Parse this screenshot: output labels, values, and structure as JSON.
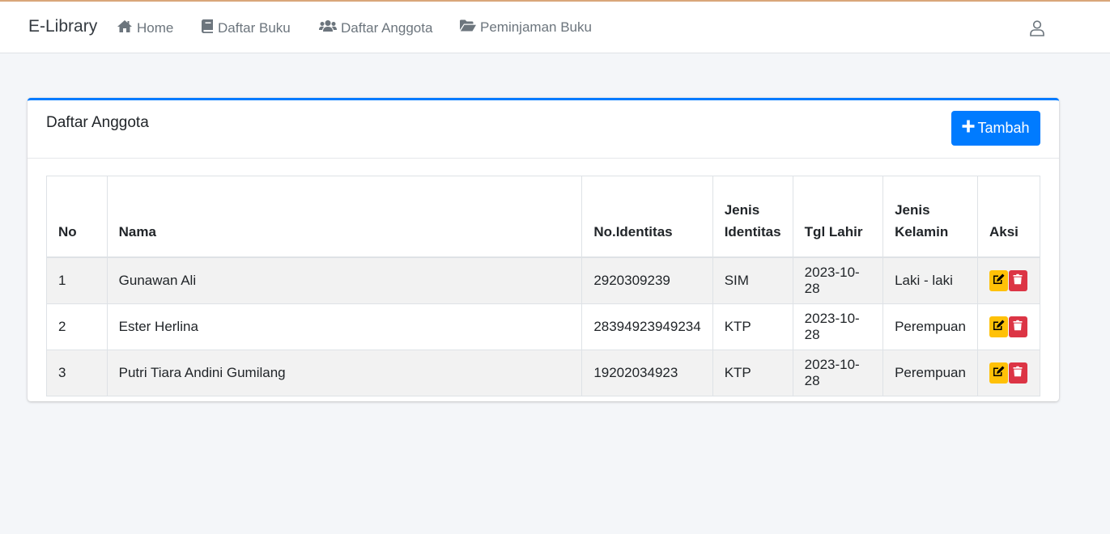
{
  "navbar": {
    "brand": "E-Library",
    "items": [
      {
        "label": "Home",
        "icon": "home-icon"
      },
      {
        "label": "Daftar Buku",
        "icon": "book-icon"
      },
      {
        "label": "Daftar Anggota",
        "icon": "users-icon"
      },
      {
        "label": "Peminjaman Buku",
        "icon": "folder-open-icon"
      }
    ],
    "user_icon": "user-icon"
  },
  "card": {
    "title": "Daftar Anggota",
    "add_button": "Tambah"
  },
  "table": {
    "headers": [
      "No",
      "Nama",
      "No.Identitas",
      "Jenis Identitas",
      "Tgl Lahir",
      "Jenis Kelamin",
      "Aksi"
    ],
    "rows": [
      {
        "no": "1",
        "nama": "Gunawan Ali",
        "no_identitas": "2920309239",
        "jenis_identitas": "SIM",
        "tgl_lahir": "2023-10-28",
        "jenis_kelamin": "Laki - laki"
      },
      {
        "no": "2",
        "nama": "Ester Herlina",
        "no_identitas": "28394923949234",
        "jenis_identitas": "KTP",
        "tgl_lahir": "2023-10-28",
        "jenis_kelamin": "Perempuan"
      },
      {
        "no": "3",
        "nama": "Putri Tiara Andini Gumilang",
        "no_identitas": "19202034923",
        "jenis_identitas": "KTP",
        "tgl_lahir": "2023-10-28",
        "jenis_kelamin": "Perempuan"
      }
    ]
  },
  "colors": {
    "primary": "#007bff",
    "warning": "#ffc107",
    "danger": "#dc3545",
    "background": "#f4f6f9"
  }
}
